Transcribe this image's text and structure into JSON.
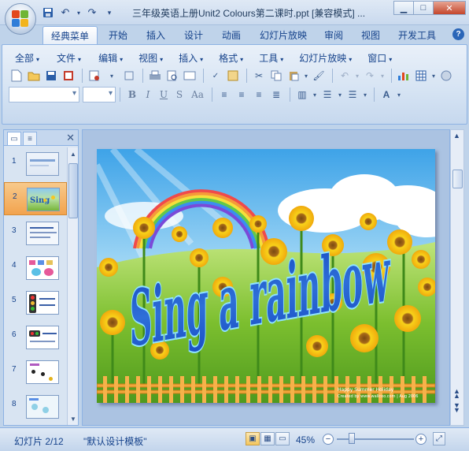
{
  "window": {
    "title": "三年级英语上册Unit2 Colours第二课时.ppt [兼容模式] ..."
  },
  "ribbon_tabs": [
    "经典菜单",
    "开始",
    "插入",
    "设计",
    "动画",
    "幻灯片放映",
    "审阅",
    "视图",
    "开发工具"
  ],
  "active_tab": "经典菜单",
  "classic_menu": [
    {
      "label": "全部"
    },
    {
      "label": "文件"
    },
    {
      "label": "编辑"
    },
    {
      "label": "视图"
    },
    {
      "label": "插入"
    },
    {
      "label": "格式"
    },
    {
      "label": "工具"
    },
    {
      "label": "幻灯片放映"
    },
    {
      "label": "窗口"
    }
  ],
  "format_buttons": [
    "B",
    "I",
    "U",
    "S",
    "Aa"
  ],
  "slides_pane": {
    "thumbnails": [
      {
        "number": "1"
      },
      {
        "number": "2",
        "selected": true
      },
      {
        "number": "3"
      },
      {
        "number": "4"
      },
      {
        "number": "5"
      },
      {
        "number": "6"
      },
      {
        "number": "7"
      },
      {
        "number": "8"
      }
    ]
  },
  "slide": {
    "wordart_text": "Sing a rainbow",
    "footer_line1": "Happy Summer Holiday",
    "footer_line2": "Created by www.wallcoo.com | Aug 2006"
  },
  "status_bar": {
    "slide_position": "幻灯片 2/12",
    "theme": "\"默认设计模板\"",
    "zoom": "45%"
  },
  "icons": {
    "office_button": "office-logo",
    "save": "save-icon",
    "undo": "undo-icon",
    "redo": "redo-icon"
  },
  "colors": {
    "ribbon": "#d5e3f3",
    "selected_thumb": "#f2a34e",
    "wordart_fill": "#2e6fd8"
  }
}
